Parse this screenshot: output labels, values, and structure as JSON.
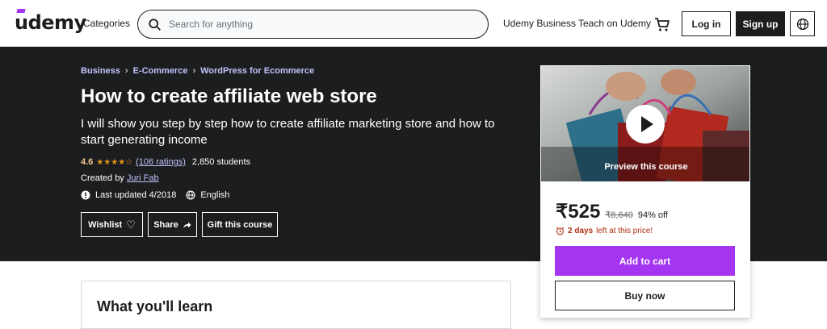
{
  "header": {
    "logo": "udemy",
    "categories": "Categories",
    "search_placeholder": "Search for anything",
    "business": "Udemy Business",
    "teach": "Teach on Udemy",
    "login": "Log in",
    "signup": "Sign up"
  },
  "course": {
    "breadcrumbs": [
      "Business",
      "E-Commerce",
      "WordPress for Ecommerce"
    ],
    "title": "How to create affiliate web store",
    "subtitle": "I will show you step by step how to create affiliate marketing store and how to start generating income",
    "rating": "4.6",
    "ratings_count": "(106 ratings)",
    "students": "2,850 students",
    "created_by_label": "Created by",
    "instructor": "Juri Fab",
    "last_updated": "Last updated 4/2018",
    "language": "English",
    "wishlist": "Wishlist",
    "share": "Share",
    "gift": "Gift this course"
  },
  "sidebar": {
    "preview_label": "Preview this course",
    "price": "₹525",
    "original_price": "₹8,640",
    "discount": "94% off",
    "timer_bold": "2 days",
    "timer_rest": "left at this price!",
    "add_to_cart": "Add to cart",
    "buy_now": "Buy now"
  },
  "learn": {
    "title": "What you'll learn"
  },
  "colors": {
    "brand": "#a435f0",
    "dark": "#1c1d1f",
    "link": "#c0c4fc",
    "rating": "#e59819",
    "urgent": "#b32d0f"
  }
}
